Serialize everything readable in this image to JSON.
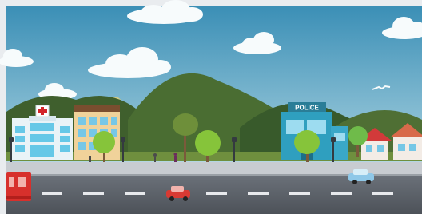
{
  "scene": {
    "police_sign": "POLICE",
    "colors": {
      "sky_top": "#3b8fb6",
      "sky_bottom": "#b7d9e4",
      "hill_dark": "#3b5b2a",
      "hill_mid": "#4f6f34",
      "grass": "#6f8f3e",
      "sidewalk": "#c8ccd1",
      "road": "#5a5f66",
      "lane": "#e7e9ec",
      "hospital": "#e9f3f7",
      "hospital_windows": "#66c8e7",
      "hospital_cross": "#d3252a",
      "apartment": "#f0d29a",
      "apartment_windows": "#76c7e6",
      "police": "#2f9fbf",
      "police_sign_bg": "#2a7d97",
      "tree": "#86c43a",
      "tree_trunk": "#7b5a3b",
      "car_red": "#d83a33",
      "car_blue": "#8fc8e8",
      "bus_red": "#d7302c",
      "house_roof": "#d23a3a",
      "house_wall": "#f3ece6"
    }
  }
}
